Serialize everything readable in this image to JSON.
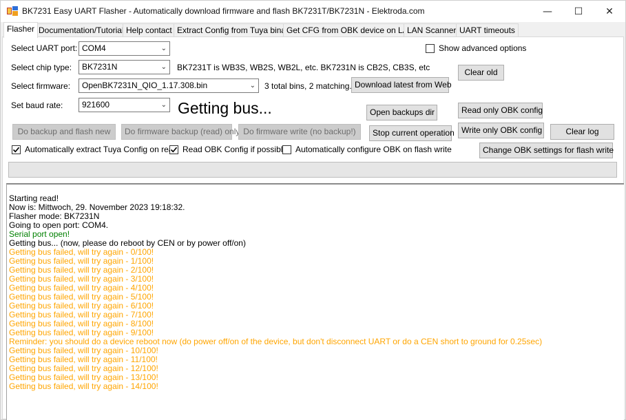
{
  "window": {
    "title": "BK7231 Easy UART Flasher - Automatically download firmware and flash BK7231T/BK7231N  - Elektroda.com",
    "minimize_glyph": "—",
    "maximize_glyph": "☐",
    "close_glyph": "✕"
  },
  "tabs": [
    {
      "label": "Flasher"
    },
    {
      "label": "Documentation/Tutorials"
    },
    {
      "label": "Help contact"
    },
    {
      "label": "Extract Config from Tuya binary"
    },
    {
      "label": "Get CFG from OBK device on LAN"
    },
    {
      "label": "LAN Scanner"
    },
    {
      "label": "UART timeouts"
    }
  ],
  "form": {
    "uart_port_label": "Select UART port:",
    "uart_port_value": "COM4",
    "chip_type_label": "Select chip type:",
    "chip_type_value": "BK7231N",
    "chip_info": "BK7231T is WB3S, WB2S, WB2L, etc. BK7231N is CB2S, CB3S, etc",
    "firmware_label": "Select firmware:",
    "firmware_value": "OpenBK7231N_QIO_1.17.308.bin",
    "firmware_info": "3 total bins, 2 matching.",
    "baud_label": "Set baud rate:",
    "baud_value": "921600",
    "status_text": "Getting bus..."
  },
  "buttons": {
    "download_latest": "Download latest from Web",
    "clear_old": "Clear old",
    "open_backups": "Open backups dir",
    "read_only_obk": "Read only OBK config",
    "stop_operation": "Stop current operation",
    "write_only_obk": "Write only OBK config",
    "clear_log": "Clear log",
    "backup_and_flash": "Do backup and flash new",
    "firmware_backup": "Do firmware backup (read) only",
    "firmware_write": "Do firmware write (no backup!)",
    "change_obk_settings": "Change OBK settings for flash write"
  },
  "checkboxes": {
    "show_advanced": {
      "label": "Show advanced options",
      "checked": false
    },
    "auto_extract_tuya": {
      "label": "Automatically extract Tuya Config on read",
      "checked": true
    },
    "read_obk_config": {
      "label": "Read OBK Config if possible",
      "checked": true
    },
    "auto_configure_obk": {
      "label": "Automatically configure OBK on flash write",
      "checked": false
    }
  },
  "progress": {
    "value_percent": 0
  },
  "log": {
    "colors": {
      "black": "#000000",
      "green": "#008000",
      "orange": "#ffa500"
    },
    "lines": [
      {
        "text": "Starting read!",
        "color": "black"
      },
      {
        "text": "Now is: Mittwoch, 29. November 2023 19:18:32.",
        "color": "black"
      },
      {
        "text": "Flasher mode: BK7231N",
        "color": "black"
      },
      {
        "text": "Going to open port: COM4.",
        "color": "black"
      },
      {
        "text": "Serial port open!",
        "color": "green"
      },
      {
        "text": "Getting bus... (now, please do reboot by CEN or by power off/on)",
        "color": "black"
      },
      {
        "text": "Getting bus failed, will try again - 0/100!",
        "color": "orange"
      },
      {
        "text": "Getting bus failed, will try again - 1/100!",
        "color": "orange"
      },
      {
        "text": "Getting bus failed, will try again - 2/100!",
        "color": "orange"
      },
      {
        "text": "Getting bus failed, will try again - 3/100!",
        "color": "orange"
      },
      {
        "text": "Getting bus failed, will try again - 4/100!",
        "color": "orange"
      },
      {
        "text": "Getting bus failed, will try again - 5/100!",
        "color": "orange"
      },
      {
        "text": "Getting bus failed, will try again - 6/100!",
        "color": "orange"
      },
      {
        "text": "Getting bus failed, will try again - 7/100!",
        "color": "orange"
      },
      {
        "text": "Getting bus failed, will try again - 8/100!",
        "color": "orange"
      },
      {
        "text": "Getting bus failed, will try again - 9/100!",
        "color": "orange"
      },
      {
        "text": "Reminder: you should do a device reboot now (do power off/on of the device, but don't disconnect UART or do a CEN short to ground for 0.25sec)",
        "color": "orange"
      },
      {
        "text": "Getting bus failed, will try again - 10/100!",
        "color": "orange"
      },
      {
        "text": "Getting bus failed, will try again - 11/100!",
        "color": "orange"
      },
      {
        "text": "Getting bus failed, will try again - 12/100!",
        "color": "orange"
      },
      {
        "text": "Getting bus failed, will try again - 13/100!",
        "color": "orange"
      },
      {
        "text": "Getting bus failed, will try again - 14/100!",
        "color": "orange"
      }
    ]
  }
}
